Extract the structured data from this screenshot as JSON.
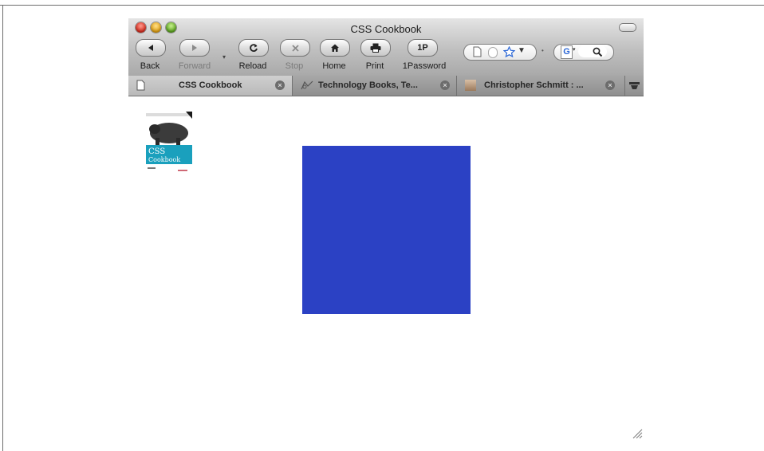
{
  "window": {
    "title": "CSS Cookbook"
  },
  "toolbar": {
    "back_label": "Back",
    "forward_label": "Forward",
    "reload_label": "Reload",
    "stop_label": "Stop",
    "home_label": "Home",
    "print_label": "Print",
    "password_label": "1Password",
    "password_button_text": "1P"
  },
  "tabs": [
    {
      "label": "CSS Cookbook",
      "active": true
    },
    {
      "label": "Technology Books, Te...",
      "active": false
    },
    {
      "label": "Christopher Schmitt : ...",
      "active": false
    }
  ],
  "page": {
    "book_cover_title": "CSS Cookbook",
    "box_color": "#2b41c4"
  },
  "colors": {
    "close": "#d62b1c",
    "minimize": "#e2a010",
    "maximize": "#5aa51d",
    "google_blue": "#2a66d6"
  }
}
